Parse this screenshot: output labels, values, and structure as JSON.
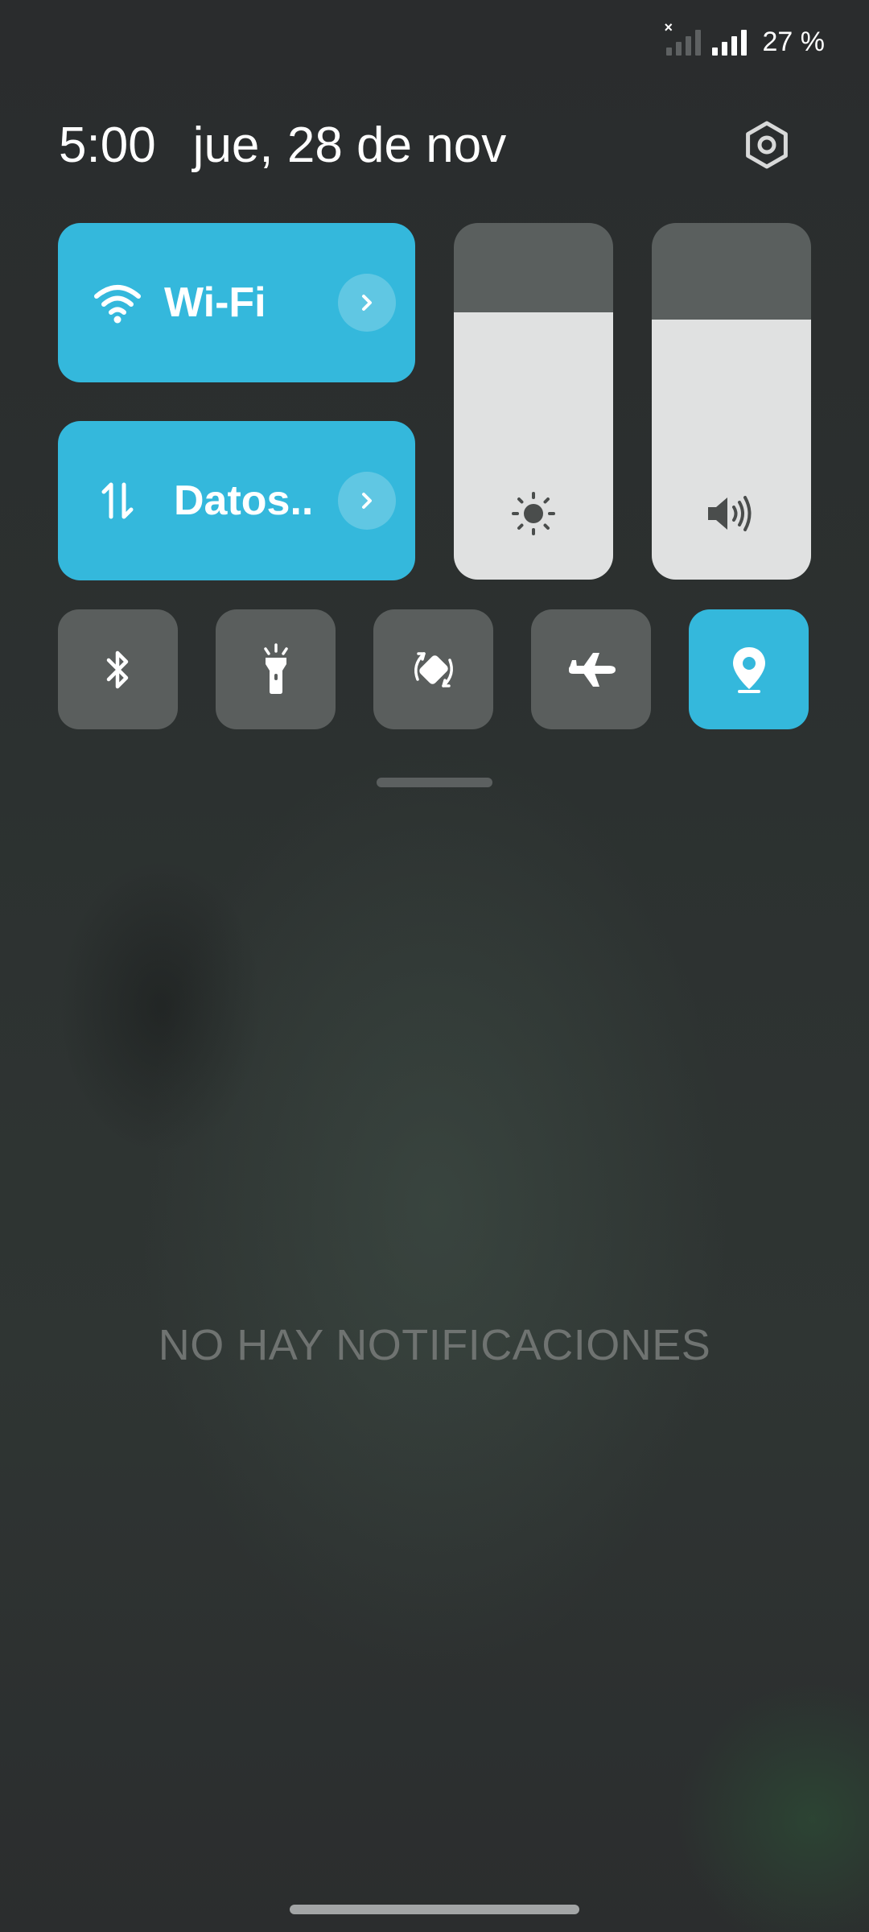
{
  "status_bar": {
    "sim1_state": "no-signal",
    "sim2_state": "full-signal",
    "battery": "27 %"
  },
  "header": {
    "time": "5:00",
    "date": "jue, 28 de nov",
    "settings_icon": "gear-icon"
  },
  "tiles": {
    "wifi": {
      "label": "Wi-Fi",
      "active": true,
      "icon": "wifi-icon"
    },
    "data": {
      "label": "Datos..",
      "active": true,
      "icon": "mobile-data-icon"
    }
  },
  "sliders": {
    "brightness": {
      "level": 0.75,
      "icon": "sun-icon"
    },
    "volume": {
      "level": 0.73,
      "icon": "speaker-icon"
    }
  },
  "toggles": [
    {
      "name": "bluetooth",
      "icon": "bluetooth-icon",
      "active": false
    },
    {
      "name": "flashlight",
      "icon": "flashlight-icon",
      "active": false
    },
    {
      "name": "auto-rotate",
      "icon": "rotate-icon",
      "active": false
    },
    {
      "name": "airplane-mode",
      "icon": "airplane-icon",
      "active": false
    },
    {
      "name": "location",
      "icon": "location-icon",
      "active": true
    }
  ],
  "notifications": {
    "empty_text": "NO HAY NOTIFICACIONES"
  },
  "colors": {
    "accent": "#34b8dc",
    "tile_inactive": "#5a5e5d",
    "slider_fill": "#e0e1e1",
    "slider_track": "#5a5f5e"
  }
}
